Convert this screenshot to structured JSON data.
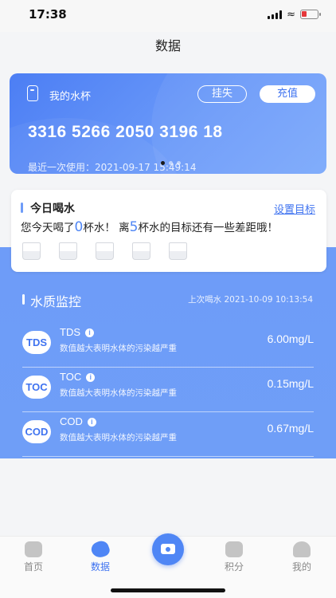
{
  "status_bar": {
    "time": "17:38"
  },
  "nav": {
    "title": "数据"
  },
  "cup_card": {
    "title": "我的水杯",
    "report_loss_label": "挂失",
    "recharge_label": "充值",
    "card_number": "3316 5266 2050 3196 18",
    "last_used": "最近一次使用：2021-09-17 15:49:14"
  },
  "drink": {
    "title": "今日喝水",
    "set_goal_label": "设置目标",
    "msg_part1": "您今天喝了",
    "cups_drunk": "0",
    "msg_part2": "杯水！ 离",
    "cups_remaining": "5",
    "msg_part3": "杯水的目标还有一些差距哦！"
  },
  "water_quality": {
    "title": "水质监控",
    "last_drink": "上次喝水 2021-10-09 10:13:54",
    "rows": [
      {
        "badge": "TDS",
        "name": "TDS",
        "desc": "数值越大表明水体的污染越严重",
        "value": "6.00mg/L"
      },
      {
        "badge": "TOC",
        "name": "TOC",
        "desc": "数值越大表明水体的污染越严重",
        "value": "0.15mg/L"
      },
      {
        "badge": "COD",
        "name": "COD",
        "desc": "数值越大表明水体的污染越严重",
        "value": "0.67mg/L"
      }
    ]
  },
  "tabbar": {
    "home": "首页",
    "data": "数据",
    "points": "积分",
    "mine": "我的"
  },
  "colors": {
    "accent": "#3f73f0",
    "blue_panel": "#6e9cf8"
  }
}
